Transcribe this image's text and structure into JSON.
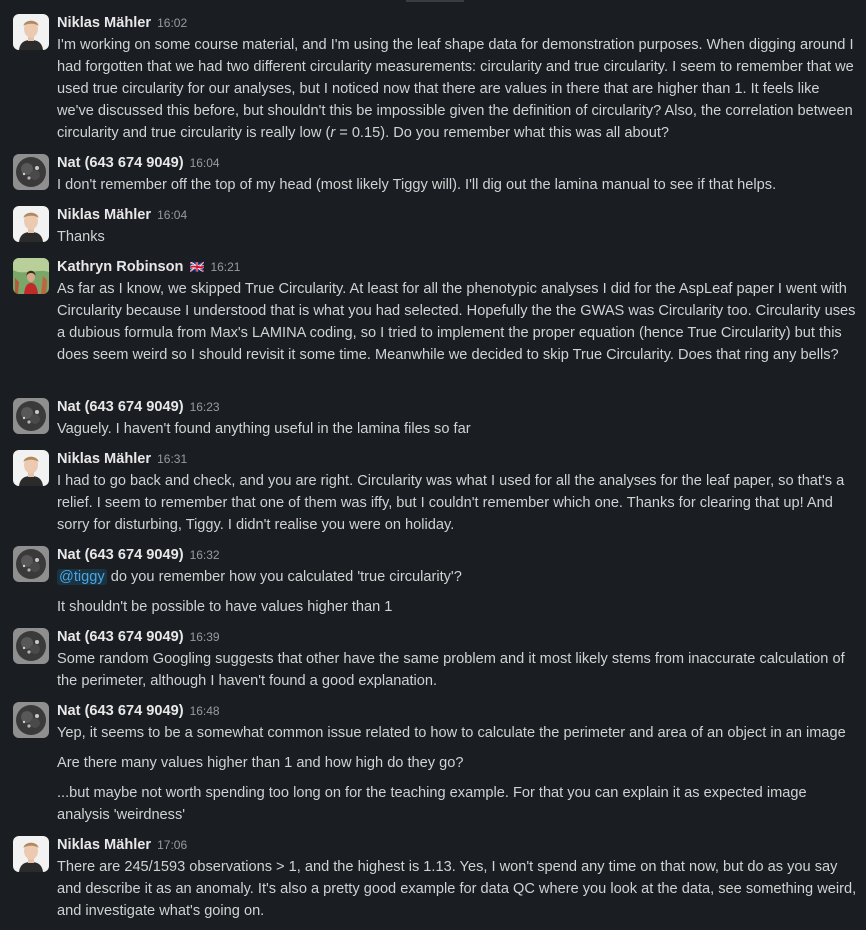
{
  "users": {
    "niklas": "Niklas Mähler",
    "nat": "Nat (643 674 9049)",
    "kathryn": "Kathryn Robinson"
  },
  "flag_uk": "🇬🇧",
  "messages": [
    {
      "time": "16:02",
      "p1": "I'm working on some course material, and I'm using the leaf shape data for demonstration purposes. When digging around I had forgotten that we had two different circularity measurements: circularity and true circularity. I seem to remember that we used true circularity for our analyses, but I noticed now that there are values in there that are higher than 1. It feels like we've discussed this before, but shouldn't this be impossible given the definition of circularity? Also, the correlation between circularity and true circularity is really low (",
      "p1_italic": "r",
      "p1_end": " = 0.15). Do you remember what this was all about?"
    },
    {
      "time": "16:04",
      "p1": "I don't remember off the top of my head (most likely Tiggy will). I'll dig out the lamina manual to see if that helps."
    },
    {
      "time": "16:04",
      "p1": "Thanks"
    },
    {
      "time": "16:21",
      "p1": "As far as I know, we skipped True Circularity. At least for all the phenotypic analyses I did for the AspLeaf paper I went with Circularity because I understood that is what you had selected. Hopefully the the GWAS was Circularity too. Circularity uses a dubious formula from Max's LAMINA coding, so I tried to implement the proper equation (hence True Circularity) but this does seem weird so I should revisit it some time. Meanwhile we decided to skip True Circularity. Does that ring any bells?"
    },
    {
      "time": "16:23",
      "p1": "Vaguely. I haven't found anything useful in the lamina files so far"
    },
    {
      "time": "16:31",
      "p1": "I had to go back and check, and you are right. Circularity was what I used for all the analyses for the leaf paper, so that's a relief. I seem to remember that one of them was iffy, but I couldn't remember which one. Thanks for clearing that up! And sorry for disturbing, Tiggy. I didn't realise you were on holiday."
    },
    {
      "time": "16:32",
      "mention": "@tiggy",
      "p1": " do you remember how you calculated 'true circularity'?",
      "p2": "It shouldn't be possible to have values higher than 1"
    },
    {
      "time": "16:39",
      "p1": "Some random Googling suggests that other have the same problem and it most likely stems from inaccurate calculation of the perimeter, although I haven't found a good explanation."
    },
    {
      "time": "16:48",
      "p1": "Yep, it seems to be a somewhat common issue related to how to calculate the perimeter and area of an object in an image",
      "p2": "Are there many values higher than 1 and how high do they go?",
      "p3": "...but maybe not worth spending too long on for the teaching example. For that you can explain it as expected image analysis 'weirdness'"
    },
    {
      "time": "17:06",
      "p1": "There are 245/1593 observations > 1, and the highest is 1.13. Yes, I won't spend any time on that now, but do as you say and describe it as an anomaly. It's also a pretty good example for data QC where you look at the data, see something weird, and investigate what's going on."
    }
  ]
}
